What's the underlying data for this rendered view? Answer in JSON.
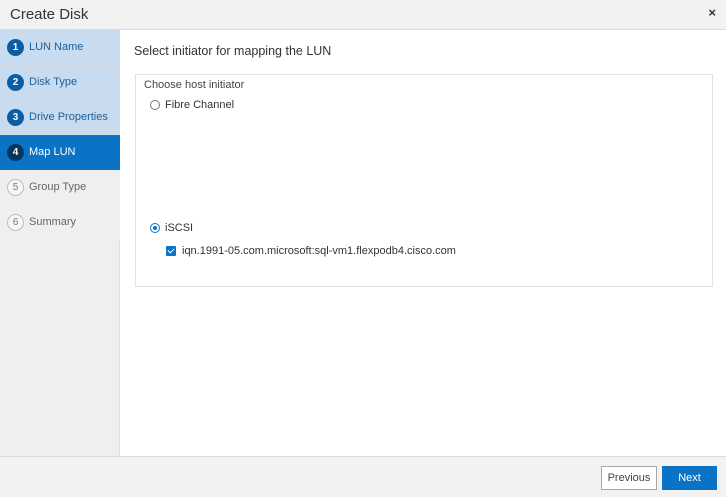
{
  "dialog": {
    "title": "Create Disk",
    "close_glyph": "×"
  },
  "steps": [
    {
      "number": "1",
      "label": "LUN Name",
      "state": "done"
    },
    {
      "number": "2",
      "label": "Disk Type",
      "state": "done"
    },
    {
      "number": "3",
      "label": "Drive Properties",
      "state": "done"
    },
    {
      "number": "4",
      "label": "Map LUN",
      "state": "active"
    },
    {
      "number": "5",
      "label": "Group Type",
      "state": "pending"
    },
    {
      "number": "6",
      "label": "Summary",
      "state": "pending"
    }
  ],
  "main": {
    "heading": "Select initiator for mapping the LUN",
    "group_label": "Choose host initiator",
    "options": [
      {
        "label": "Fibre Channel",
        "selected": false
      },
      {
        "label": "iSCSI",
        "selected": true
      }
    ],
    "initiators": [
      {
        "label": "iqn.1991-05.com.microsoft:sql-vm1.flexpodb4.cisco.com",
        "checked": true
      }
    ]
  },
  "footer": {
    "previous_label": "Previous",
    "next_label": "Next"
  },
  "colors": {
    "accent": "#0b73c6",
    "step_done_bg": "#c9dcef",
    "step_pending_bg": "#efefef"
  }
}
